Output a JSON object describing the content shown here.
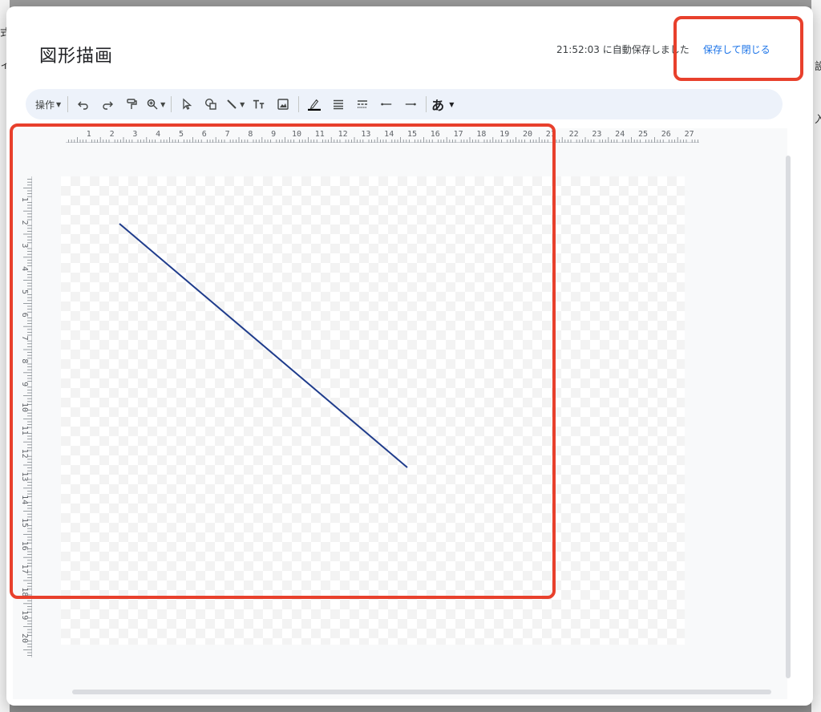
{
  "dialog": {
    "title": "図形描画",
    "autosave_text": "21:52:03 に自動保存しました",
    "save_close_label": "保存して閉じる"
  },
  "toolbar": {
    "actions_label": "操作",
    "text_format_label": "あ",
    "icons": [
      "undo-icon",
      "redo-icon",
      "paint-format-icon",
      "zoom-icon",
      "select-icon",
      "shape-icon",
      "line-icon",
      "textbox-icon",
      "image-icon",
      "line-color-icon",
      "line-weight-icon",
      "line-dash-icon",
      "line-start-icon",
      "line-end-icon"
    ]
  },
  "rulers": {
    "horizontal_labels": [
      "1",
      "2",
      "3",
      "4",
      "5",
      "6",
      "7",
      "8",
      "9",
      "10",
      "11",
      "12",
      "13",
      "14",
      "15",
      "16",
      "17",
      "18",
      "19",
      "20",
      "21",
      "22",
      "23",
      "24",
      "25",
      "26",
      "27"
    ],
    "vertical_labels": [
      "1",
      "2",
      "3",
      "4",
      "5",
      "6",
      "7",
      "8",
      "9",
      "10",
      "11",
      "12",
      "13",
      "14",
      "15",
      "16",
      "17",
      "18",
      "19",
      "20"
    ]
  },
  "canvas": {
    "shape": "line",
    "line_color": "#1f3c8c"
  },
  "background_app": {
    "left_chars": [
      "式",
      "ィ"
    ],
    "right_chars": [
      "設",
      "入"
    ]
  },
  "colors": {
    "accent": "#1a73e8",
    "highlight": "#e8402c",
    "toolbar_bg": "#edf2fa"
  }
}
